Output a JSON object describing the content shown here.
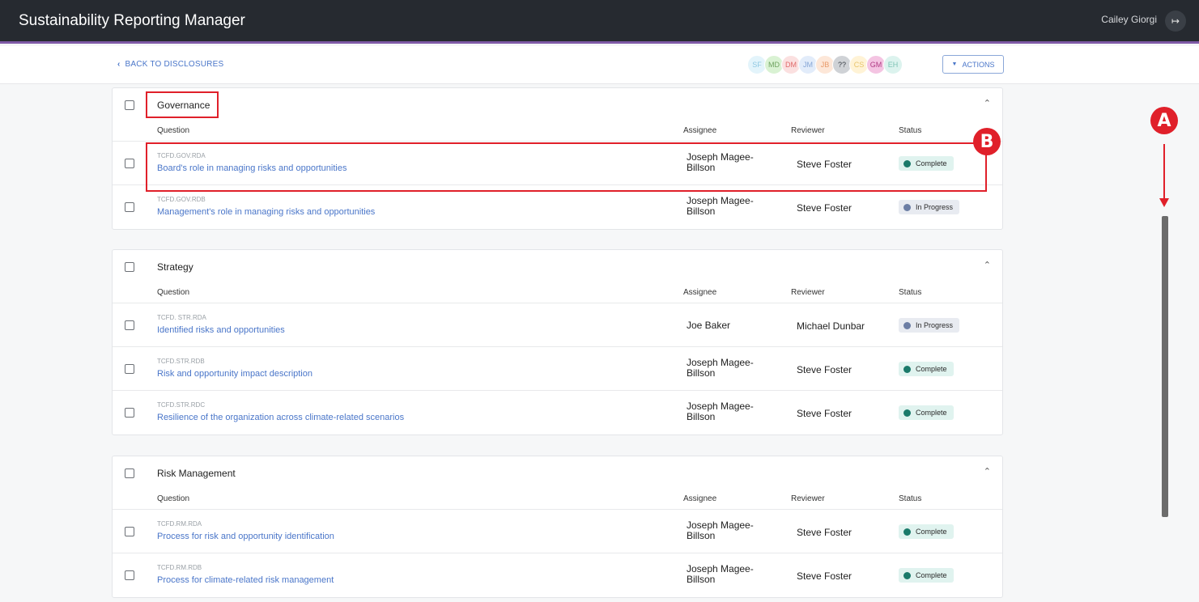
{
  "app": {
    "title": "Sustainability Reporting Manager",
    "user_name": "Cailey Giorgi",
    "logout_icon": "logout-icon"
  },
  "subbar": {
    "back_label": "BACK TO DISCLOSURES",
    "actions_label": "ACTIONS",
    "avatars": [
      {
        "initials": "SF",
        "bg": "#e3f4fb",
        "fg": "#8fc8e2"
      },
      {
        "initials": "MD",
        "bg": "#d9f2d3",
        "fg": "#6ea25f"
      },
      {
        "initials": "DM",
        "bg": "#fbe0e0",
        "fg": "#e06a6a"
      },
      {
        "initials": "JM",
        "bg": "#e2ecfa",
        "fg": "#86a6d6"
      },
      {
        "initials": "JB",
        "bg": "#fde7d8",
        "fg": "#e89a6a"
      },
      {
        "initials": "??",
        "bg": "#cfd2d6",
        "fg": "#3a3f46"
      },
      {
        "initials": "CS",
        "bg": "#fff3d6",
        "fg": "#e8c46a"
      },
      {
        "initials": "GM",
        "bg": "#f4c4e2",
        "fg": "#b03a84"
      },
      {
        "initials": "EH",
        "bg": "#dcf3ee",
        "fg": "#7cc3b4"
      }
    ]
  },
  "columns": {
    "question": "Question",
    "assignee": "Assignee",
    "reviewer": "Reviewer",
    "status": "Status"
  },
  "sections": [
    {
      "title": "Governance",
      "rows": [
        {
          "code": "TCFD.GOV.RDA",
          "question": "Board's role in managing risks and opportunities",
          "assignee": "Joseph Magee-Billson",
          "reviewer": "Steve Foster",
          "status": "Complete"
        },
        {
          "code": "TCFD.GOV.RDB",
          "question": "Management's role in managing risks and opportunities",
          "assignee": "Joseph Magee-Billson",
          "reviewer": "Steve Foster",
          "status": "In Progress"
        }
      ]
    },
    {
      "title": "Strategy",
      "rows": [
        {
          "code": "TCFD. STR.RDA",
          "question": "Identified risks and opportunities",
          "assignee": "Joe Baker",
          "reviewer": "Michael Dunbar",
          "status": "In Progress"
        },
        {
          "code": "TCFD.STR.RDB",
          "question": "Risk and opportunity impact description",
          "assignee": "Joseph Magee-Billson",
          "reviewer": "Steve Foster",
          "status": "Complete"
        },
        {
          "code": "TCFD.STR.RDC",
          "question": "Resilience of the organization across climate-related scenarios",
          "assignee": "Joseph Magee-Billson",
          "reviewer": "Steve Foster",
          "status": "Complete"
        }
      ]
    },
    {
      "title": "Risk Management",
      "rows": [
        {
          "code": "TCFD.RM.RDA",
          "question": "Process for risk and opportunity identification",
          "assignee": "Joseph Magee-Billson",
          "reviewer": "Steve Foster",
          "status": "Complete"
        },
        {
          "code": "TCFD.RM.RDB",
          "question": "Process for climate-related risk management",
          "assignee": "Joseph Magee-Billson",
          "reviewer": "Steve Foster",
          "status": "Complete"
        }
      ]
    }
  ],
  "annotations": {
    "marker_a": "A",
    "marker_b": "B",
    "color": "#e0202a"
  }
}
